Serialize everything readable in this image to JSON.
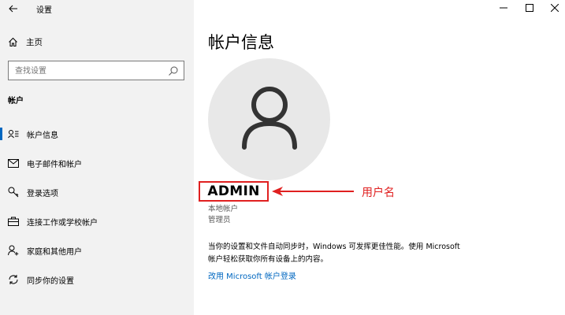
{
  "window": {
    "title": "设置"
  },
  "sidebar": {
    "home_label": "主页",
    "search_placeholder": "查找设置",
    "section_title": "帐户",
    "items": [
      {
        "label": "帐户信息",
        "icon": "account-info-icon",
        "active": true
      },
      {
        "label": "电子邮件和帐户",
        "icon": "mail-icon",
        "active": false
      },
      {
        "label": "登录选项",
        "icon": "key-icon",
        "active": false
      },
      {
        "label": "连接工作或学校帐户",
        "icon": "briefcase-icon",
        "active": false
      },
      {
        "label": "家庭和其他用户",
        "icon": "person-add-icon",
        "active": false
      },
      {
        "label": "同步你的设置",
        "icon": "sync-icon",
        "active": false
      }
    ]
  },
  "main": {
    "page_title": "帐户信息",
    "username": "ADMIN",
    "account_type": "本地帐户",
    "role": "管理员",
    "description": "当你的设置和文件自动同步时，Windows 可发挥更佳性能。使用 Microsoft 帐户轻松获取你所有设备上的内容。",
    "ms_link": "改用 Microsoft 帐户登录"
  },
  "annotation": {
    "label": "用户名",
    "color": "#e02020"
  },
  "colors": {
    "accent": "#0067c0",
    "sidebar_bg": "#f2f2f2",
    "avatar_bg": "#e8e8e8"
  }
}
